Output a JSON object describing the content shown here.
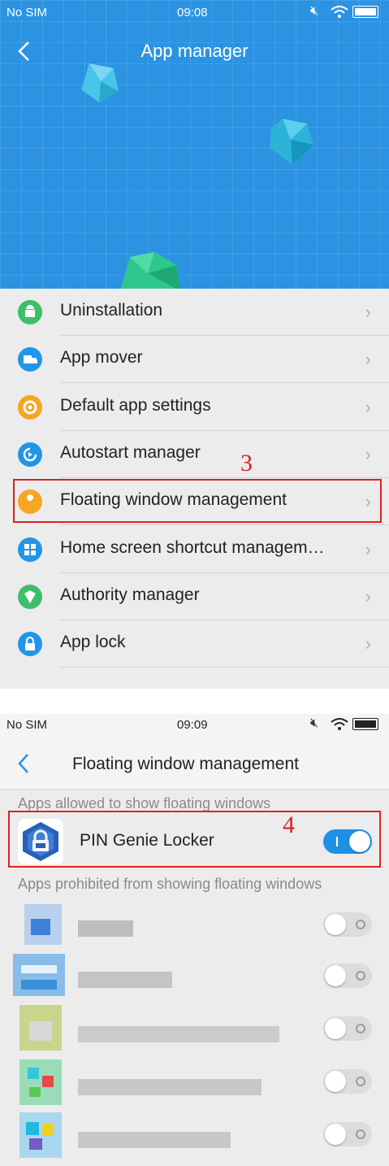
{
  "screen1": {
    "status": {
      "carrier": "No SIM",
      "time": "09:08"
    },
    "header": {
      "title": "App manager"
    },
    "menu": [
      {
        "label": "Uninstallation",
        "icon": "android-icon",
        "color": "#3cbf6a"
      },
      {
        "label": "App mover",
        "icon": "truck-icon",
        "color": "#2196e8"
      },
      {
        "label": "Default app settings",
        "icon": "gear-icon",
        "color": "#f5a623"
      },
      {
        "label": "Autostart manager",
        "icon": "autostart-icon",
        "color": "#2196e8"
      },
      {
        "label": "Floating window management",
        "icon": "wrench-icon",
        "color": "#f5a623"
      },
      {
        "label": "Home screen shortcut managem…",
        "icon": "grid-icon",
        "color": "#2196e8"
      },
      {
        "label": "Authority manager",
        "icon": "shield-icon",
        "color": "#3cbf6a"
      },
      {
        "label": "App lock",
        "icon": "lock-icon",
        "color": "#2196e8"
      }
    ],
    "annotation": "3"
  },
  "screen2": {
    "status": {
      "carrier": "No SIM",
      "time": "09:09"
    },
    "header": {
      "title": "Floating window management"
    },
    "allowed_header": "Apps allowed to show floating windows",
    "allowed_app": {
      "name": "PIN Genie Locker",
      "enabled": true
    },
    "prohibited_header": "Apps prohibited from showing floating windows",
    "annotation": "4"
  },
  "colors": {
    "accent": "#2196e8",
    "annotation": "#e02020"
  }
}
